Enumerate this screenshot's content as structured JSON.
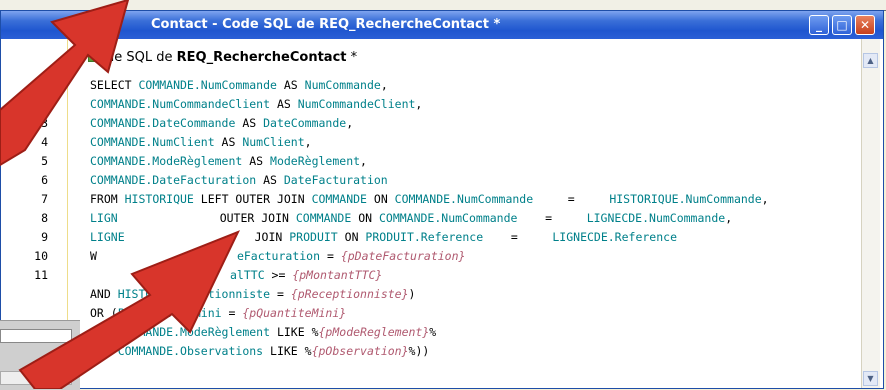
{
  "window": {
    "title": "Contact - Code SQL de REQ_RechercheContact *",
    "header_prefix": "de SQL de ",
    "header_query": "REQ_RechercheContact",
    "header_suffix": " *"
  },
  "controls": {
    "minimize": "_",
    "maximize": "□",
    "close": "✕"
  },
  "line_numbers": [
    "2",
    "3",
    "4",
    "5",
    "6",
    "7",
    "8",
    "9",
    "10",
    "11"
  ],
  "code": {
    "l1": [
      "SELECT ",
      "COMMANDE.NumCommande",
      " AS ",
      "NumCommande",
      ","
    ],
    "l2": [
      "COMMANDE.NumCommandeClient",
      " AS ",
      "NumCommandeClient",
      ","
    ],
    "l3": [
      "COMMANDE.DateCommande",
      " AS ",
      "DateCommande",
      ","
    ],
    "l4": [
      "COMMANDE.NumClient",
      " AS ",
      "NumClient",
      ","
    ],
    "l5": [
      "COMMANDE.ModeRèglement",
      " AS ",
      "ModeRèglement",
      ","
    ],
    "l6": [
      "COMMANDE.DateFacturation",
      " AS ",
      "DateFacturation"
    ],
    "l7": [
      "FROM ",
      "HISTORIQUE",
      " LEFT OUTER JOIN ",
      "COMMANDE",
      " ON ",
      "COMMANDE.NumCommande",
      "     =     ",
      "HISTORIQUE.NumCommande",
      ","
    ],
    "l8": [
      "LIGN",
      "OUTER JOIN ",
      "COMMANDE",
      " ON ",
      "COMMANDE.NumCommande",
      "    =     ",
      "LIGNECDE.NumCommande",
      ","
    ],
    "l9": [
      "LIGNE",
      "JOIN ",
      "PRODUIT",
      " ON ",
      "PRODUIT.Reference",
      "    =     ",
      "LIGNECDE.Reference"
    ],
    "l10": [
      "W",
      "eFacturation",
      " = ",
      "{pDateFacturation}"
    ],
    "l11": [
      "alTTC",
      " >= ",
      "{pMontantTTC}"
    ],
    "l12": [
      "AND ",
      "HISTORI",
      ".Réceptionniste",
      " = ",
      "{pReceptionniste}",
      ")"
    ],
    "l13": [
      "OR (",
      "PRODUIT.QteMini",
      " = ",
      "{pQuantiteMini}"
    ],
    "l14": [
      "AND ",
      "COMMANDE.ModeRèglement",
      " LIKE %",
      "{pModeReglement}",
      "%"
    ],
    "l15": [
      "AND ",
      "COMMANDE.Observations",
      " LIKE %",
      "{pObservation}",
      "%))"
    ]
  },
  "scrollbar": {
    "up": "▲",
    "down": "▼"
  },
  "colors": {
    "keyword": "#000000",
    "table": "#00808a",
    "param": "#b05a70",
    "arrow": "#d8352b",
    "titlebar": "#2a5fd6"
  }
}
